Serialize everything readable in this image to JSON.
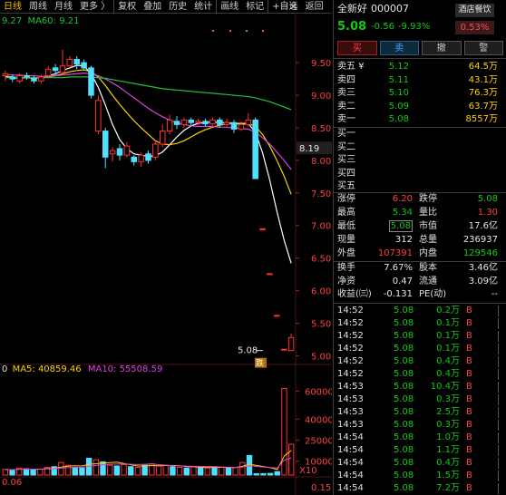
{
  "toolbar": {
    "items": [
      {
        "label": "日线",
        "active": true
      },
      {
        "label": "周线",
        "active": false
      },
      {
        "label": "月线",
        "active": false
      },
      {
        "label": "更多 〉",
        "active": false
      },
      {
        "label": "复权",
        "active": false
      },
      {
        "label": "叠加",
        "active": false
      },
      {
        "label": "历史",
        "active": false
      },
      {
        "label": "统计",
        "active": false
      },
      {
        "label": "画线",
        "active": false
      },
      {
        "label": "标记",
        "active": false
      },
      {
        "label": "+自选",
        "active": false
      },
      {
        "label": "返回",
        "active": false
      }
    ],
    "close_glyph": "✕"
  },
  "chart": {
    "ma_legend_top": {
      "ma30": "9.27",
      "ma60_label": "MA60: 9.21"
    },
    "ma_legend_vol": {
      "prefix": "0",
      "ma5": "MA5: 40859.46",
      "ma10": "MA10: 55508.59"
    },
    "last_price_label": "5.08",
    "tag_label": "跌",
    "current_price_marker": "8.19",
    "bottom_left": "0.06",
    "bottom_right": "0.15",
    "x10_label": "X10"
  },
  "chart_data": [
    {
      "type": "candlestick",
      "title": "",
      "yticks": [
        "9.50",
        "9.00",
        "8.50",
        "8.00",
        "7.50",
        "7.00",
        "6.50",
        "6.00",
        "5.50",
        "5.00"
      ],
      "ylim": [
        4.95,
        9.85
      ],
      "candles": [
        {
          "o": 9.3,
          "c": 9.33,
          "h": 9.38,
          "l": 9.22
        },
        {
          "o": 9.28,
          "c": 9.25,
          "h": 9.32,
          "l": 9.2
        },
        {
          "o": 9.22,
          "c": 9.3,
          "h": 9.34,
          "l": 9.18
        },
        {
          "o": 9.3,
          "c": 9.28,
          "h": 9.35,
          "l": 9.24
        },
        {
          "o": 9.25,
          "c": 9.22,
          "h": 9.3,
          "l": 9.18
        },
        {
          "o": 9.22,
          "c": 9.28,
          "h": 9.32,
          "l": 9.18
        },
        {
          "o": 9.3,
          "c": 9.4,
          "h": 9.45,
          "l": 9.28
        },
        {
          "o": 9.42,
          "c": 9.38,
          "h": 9.48,
          "l": 9.3
        },
        {
          "o": 9.35,
          "c": 9.45,
          "h": 9.7,
          "l": 9.3
        },
        {
          "o": 9.45,
          "c": 9.55,
          "h": 9.6,
          "l": 9.42
        },
        {
          "o": 9.55,
          "c": 9.48,
          "h": 9.6,
          "l": 9.4
        },
        {
          "o": 9.5,
          "c": 9.42,
          "h": 9.55,
          "l": 9.38
        },
        {
          "o": 9.42,
          "c": 9.0,
          "h": 9.45,
          "l": 8.95
        },
        {
          "o": 8.45,
          "c": 8.92,
          "h": 9.0,
          "l": 8.4
        },
        {
          "o": 8.45,
          "c": 8.05,
          "h": 8.5,
          "l": 7.88
        },
        {
          "o": 8.1,
          "c": 8.15,
          "h": 8.2,
          "l": 7.98
        },
        {
          "o": 8.18,
          "c": 8.08,
          "h": 8.25,
          "l": 8.0
        },
        {
          "o": 8.08,
          "c": 8.22,
          "h": 8.28,
          "l": 8.05
        },
        {
          "o": 8.05,
          "c": 7.98,
          "h": 8.08,
          "l": 7.92
        },
        {
          "o": 7.98,
          "c": 8.08,
          "h": 8.12,
          "l": 7.9
        },
        {
          "o": 8.1,
          "c": 8.0,
          "h": 8.15,
          "l": 7.95
        },
        {
          "o": 8.05,
          "c": 8.25,
          "h": 8.3,
          "l": 8.0
        },
        {
          "o": 8.25,
          "c": 8.45,
          "h": 8.55,
          "l": 8.2
        },
        {
          "o": 8.45,
          "c": 8.62,
          "h": 8.7,
          "l": 8.4
        },
        {
          "o": 8.6,
          "c": 8.55,
          "h": 8.68,
          "l": 8.48
        },
        {
          "o": 8.55,
          "c": 8.62,
          "h": 8.66,
          "l": 8.5
        },
        {
          "o": 8.62,
          "c": 8.58,
          "h": 8.66,
          "l": 8.52
        },
        {
          "o": 8.58,
          "c": 8.6,
          "h": 8.64,
          "l": 8.54
        },
        {
          "o": 8.6,
          "c": 8.56,
          "h": 8.64,
          "l": 8.52
        },
        {
          "o": 8.56,
          "c": 8.62,
          "h": 8.66,
          "l": 8.52
        },
        {
          "o": 8.62,
          "c": 8.55,
          "h": 8.66,
          "l": 8.5
        },
        {
          "o": 8.55,
          "c": 8.58,
          "h": 8.64,
          "l": 8.5
        },
        {
          "o": 8.58,
          "c": 8.48,
          "h": 8.62,
          "l": 8.42
        },
        {
          "o": 8.48,
          "c": 8.55,
          "h": 8.6,
          "l": 8.45
        },
        {
          "o": 8.55,
          "c": 8.62,
          "h": 8.72,
          "l": 8.52
        },
        {
          "o": 8.62,
          "c": 7.72,
          "h": 8.66,
          "l": 7.72
        },
        {
          "o": 6.95,
          "c": 6.95,
          "h": 6.95,
          "l": 6.95
        },
        {
          "o": 6.26,
          "c": 6.26,
          "h": 6.26,
          "l": 6.26
        },
        {
          "o": 5.62,
          "c": 5.62,
          "h": 5.62,
          "l": 5.62
        },
        {
          "o": 5.1,
          "c": 5.1,
          "h": 5.1,
          "l": 5.1
        },
        {
          "o": 5.08,
          "c": 5.28,
          "h": 5.34,
          "l": 5.08
        }
      ],
      "ma_series": [
        {
          "color": "#ffffff",
          "values": [
            9.28,
            9.27,
            9.26,
            9.27,
            9.26,
            9.27,
            9.3,
            9.33,
            9.38,
            9.42,
            9.46,
            9.45,
            9.33,
            9.12,
            8.85,
            8.55,
            8.32,
            8.18,
            8.1,
            8.08,
            8.06,
            8.07,
            8.13,
            8.24,
            8.36,
            8.46,
            8.53,
            8.57,
            8.58,
            8.59,
            8.58,
            8.58,
            8.57,
            8.55,
            8.57,
            8.43,
            8.12,
            7.7,
            7.22,
            6.78,
            6.42
          ]
        },
        {
          "color": "#ffd200",
          "values": [
            9.29,
            9.28,
            9.27,
            9.27,
            9.27,
            9.27,
            9.28,
            9.3,
            9.33,
            9.36,
            9.38,
            9.39,
            9.36,
            9.28,
            9.15,
            9.0,
            8.86,
            8.73,
            8.61,
            8.5,
            8.4,
            8.3,
            8.25,
            8.24,
            8.26,
            8.3,
            8.36,
            8.42,
            8.47,
            8.51,
            8.54,
            8.56,
            8.57,
            8.57,
            8.57,
            8.52,
            8.4,
            8.22,
            8.0,
            7.76,
            7.48
          ]
        },
        {
          "color": "#e040e0",
          "values": [
            9.32,
            9.31,
            9.31,
            9.3,
            9.3,
            9.29,
            9.29,
            9.3,
            9.31,
            9.32,
            9.33,
            9.34,
            9.33,
            9.3,
            9.25,
            9.19,
            9.12,
            9.04,
            8.96,
            8.88,
            8.8,
            8.73,
            8.67,
            8.62,
            8.58,
            8.55,
            8.53,
            8.52,
            8.52,
            8.52,
            8.51,
            8.51,
            8.5,
            8.49,
            8.48,
            8.43,
            8.35,
            8.25,
            8.13,
            8.0,
            7.86
          ]
        },
        {
          "color": "#20c040",
          "values": [
            9.27,
            9.27,
            9.27,
            9.27,
            9.27,
            9.27,
            9.27,
            9.27,
            9.27,
            9.28,
            9.28,
            9.28,
            9.28,
            9.27,
            9.26,
            9.24,
            9.22,
            9.2,
            9.18,
            9.16,
            9.14,
            9.12,
            9.1,
            9.09,
            9.08,
            9.07,
            9.06,
            9.05,
            9.04,
            9.03,
            9.02,
            9.01,
            9.0,
            8.99,
            8.98,
            8.96,
            8.93,
            8.9,
            8.86,
            8.82,
            8.78
          ]
        }
      ]
    },
    {
      "type": "bar",
      "title": "",
      "yticks": [
        "60000",
        "40000",
        "25000",
        "10000"
      ],
      "ylim": [
        0,
        72000
      ],
      "values": [
        4000,
        3500,
        5000,
        4500,
        3800,
        4200,
        5500,
        6000,
        9000,
        7000,
        5500,
        5000,
        12000,
        11000,
        9500,
        7000,
        6500,
        7500,
        6000,
        5500,
        7000,
        8000,
        6500,
        7000,
        6000,
        5500,
        5000,
        6000,
        5500,
        5000,
        6000,
        5500,
        5000,
        5500,
        9000,
        14000,
        1000,
        1000,
        1200,
        2500,
        62000,
        22000
      ],
      "up_flags": [
        1,
        0,
        1,
        0,
        0,
        1,
        1,
        0,
        1,
        1,
        0,
        0,
        0,
        1,
        0,
        1,
        0,
        1,
        0,
        1,
        0,
        1,
        1,
        1,
        0,
        1,
        0,
        1,
        0,
        1,
        0,
        1,
        0,
        1,
        1,
        0,
        0,
        0,
        0,
        0,
        1,
        1
      ]
    }
  ],
  "panel": {
    "name": "全新好",
    "code": "000007",
    "tag": "酒店餐饮",
    "last": "5.08",
    "change": "-0.56",
    "change_pct": "-9.93%",
    "wb": "0.53%",
    "buttons": {
      "buy": "买",
      "sell": "卖",
      "cancel": "撤",
      "alert": "警"
    },
    "asks": [
      {
        "label": "卖五 ¥",
        "price": "5.12",
        "vol": "64.5万"
      },
      {
        "label": "卖四",
        "price": "5.11",
        "vol": "43.1万"
      },
      {
        "label": "卖三",
        "price": "5.10",
        "vol": "76.3万"
      },
      {
        "label": "卖二",
        "price": "5.09",
        "vol": "63.7万"
      },
      {
        "label": "卖一",
        "price": "5.08",
        "vol": "8557万"
      }
    ],
    "bids": [
      {
        "label": "买一"
      },
      {
        "label": "买二"
      },
      {
        "label": "买三"
      },
      {
        "label": "买四"
      },
      {
        "label": "买五"
      }
    ],
    "stats": [
      {
        "l1": "涨停",
        "v1": "6.20",
        "c1": "red",
        "l2": "跌停",
        "v2": "5.08",
        "c2": "green"
      },
      {
        "l1": "最高",
        "v1": "5.34",
        "c1": "green",
        "l2": "量比",
        "v2": "1.30",
        "c2": "red"
      },
      {
        "l1": "最低",
        "v1": "5.08",
        "c1": "green boxed",
        "l2": "市值",
        "v2": "17.6亿",
        "c2": "white"
      },
      {
        "l1": "现量",
        "v1": "312",
        "c1": "white",
        "l2": "总量",
        "v2": "236937",
        "c2": "white"
      },
      {
        "l1": "外盘",
        "v1": "107391",
        "c1": "red",
        "l2": "内盘",
        "v2": "129546",
        "c2": "green"
      }
    ],
    "stats2": [
      {
        "l1": "换手",
        "v1": "7.67%",
        "c1": "white",
        "l2": "股本",
        "v2": "3.46亿",
        "c2": "white"
      },
      {
        "l1": "净资",
        "v1": "0.47",
        "c1": "white",
        "l2": "流通",
        "v2": "3.09亿",
        "c2": "white"
      },
      {
        "l1": "收益(㈢)",
        "v1": "-0.131",
        "c1": "white",
        "l2": "PE(动)",
        "v2": "--",
        "c2": "white"
      }
    ],
    "ticks": [
      {
        "t": "14:52",
        "p": "5.08",
        "q": "0.2万",
        "s": "B"
      },
      {
        "t": "14:52",
        "p": "5.08",
        "q": "0.1万",
        "s": "B"
      },
      {
        "t": "14:52",
        "p": "5.08",
        "q": "0.1万",
        "s": "B"
      },
      {
        "t": "14:52",
        "p": "5.08",
        "q": "0.1万",
        "s": "B"
      },
      {
        "t": "14:52",
        "p": "5.08",
        "q": "0.4万",
        "s": "B"
      },
      {
        "t": "14:52",
        "p": "5.08",
        "q": "0.4万",
        "s": "B"
      },
      {
        "t": "14:53",
        "p": "5.08",
        "q": "10.4万",
        "s": "B"
      },
      {
        "t": "14:53",
        "p": "5.08",
        "q": "0.3万",
        "s": "B"
      },
      {
        "t": "14:53",
        "p": "5.08",
        "q": "2.5万",
        "s": "B"
      },
      {
        "t": "14:53",
        "p": "5.08",
        "q": "0.3万",
        "s": "B"
      },
      {
        "t": "14:54",
        "p": "5.08",
        "q": "1.0万",
        "s": "B"
      },
      {
        "t": "14:54",
        "p": "5.08",
        "q": "1.1万",
        "s": "B"
      },
      {
        "t": "14:54",
        "p": "5.08",
        "q": "0.4万",
        "s": "B"
      },
      {
        "t": "14:54",
        "p": "5.08",
        "q": "1.5万",
        "s": "B"
      },
      {
        "t": "14:54",
        "p": "5.08",
        "q": "7.2万",
        "s": "B"
      }
    ]
  }
}
